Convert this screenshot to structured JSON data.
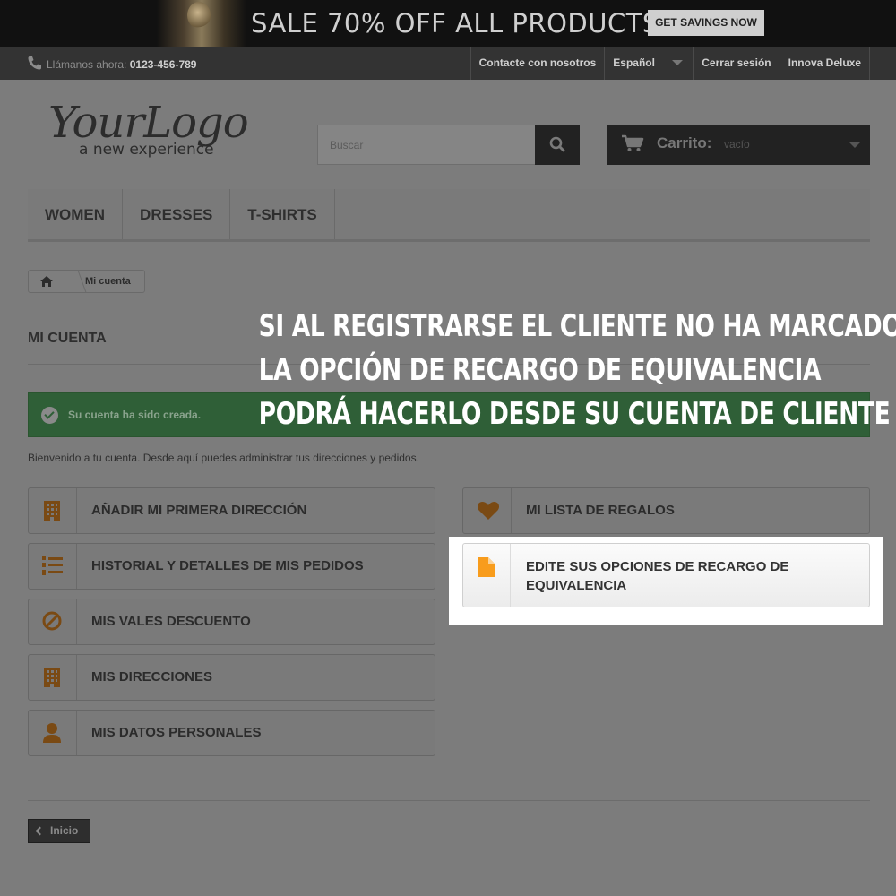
{
  "promo": {
    "text": "SALE 70% OFF ALL PRODUCTS",
    "button": "GET SAVINGS NOW"
  },
  "topbar": {
    "phone_label": "Llámanos ahora:",
    "phone_number": "0123-456-789",
    "links": [
      "Contacte con nosotros",
      "Español",
      "Cerrar sesión",
      "Innova Deluxe"
    ]
  },
  "logo": {
    "main": "YourLogo",
    "tagline": "a new experience"
  },
  "search": {
    "placeholder": "Buscar"
  },
  "cart": {
    "label": "Carrito:",
    "state": "vacío"
  },
  "menu": [
    "WOMEN",
    "DRESSES",
    "T-SHIRTS"
  ],
  "breadcrumb": {
    "current": "Mi cuenta"
  },
  "page_title": "MI CUENTA",
  "alert": "Su cuenta ha sido creada.",
  "welcome": "Bienvenido a tu cuenta. Desde aquí puedes administrar tus direcciones y pedidos.",
  "account_left": [
    {
      "label": "AÑADIR MI PRIMERA DIRECCIÓN",
      "icon": "building-icon"
    },
    {
      "label": "HISTORIAL Y DETALLES DE MIS PEDIDOS",
      "icon": "list-ol-icon"
    },
    {
      "label": "MIS VALES DESCUENTO",
      "icon": "ban-icon"
    },
    {
      "label": "MIS DIRECCIONES",
      "icon": "building-icon"
    },
    {
      "label": "MIS DATOS PERSONALES",
      "icon": "user-icon"
    }
  ],
  "account_right": [
    {
      "label": "MI LISTA DE REGALOS",
      "icon": "heart-icon"
    },
    {
      "label": "EDITE SUS OPCIONES DE RECARGO DE EQUIVALENCIA",
      "icon": "file-icon"
    }
  ],
  "home_button": "Inicio",
  "caption": [
    "SI AL REGISTRARSE EL CLIENTE NO HA MARCADO",
    "LA OPCIÓN DE RECARGO DE EQUIVALENCIA",
    "PODRÁ HACERLO DESDE SU CUENTA DE CLIENTE"
  ],
  "colors": {
    "accent": "#f89c1c",
    "dim_icon": "#7a4a14",
    "alert_green": "#2f5f37"
  }
}
